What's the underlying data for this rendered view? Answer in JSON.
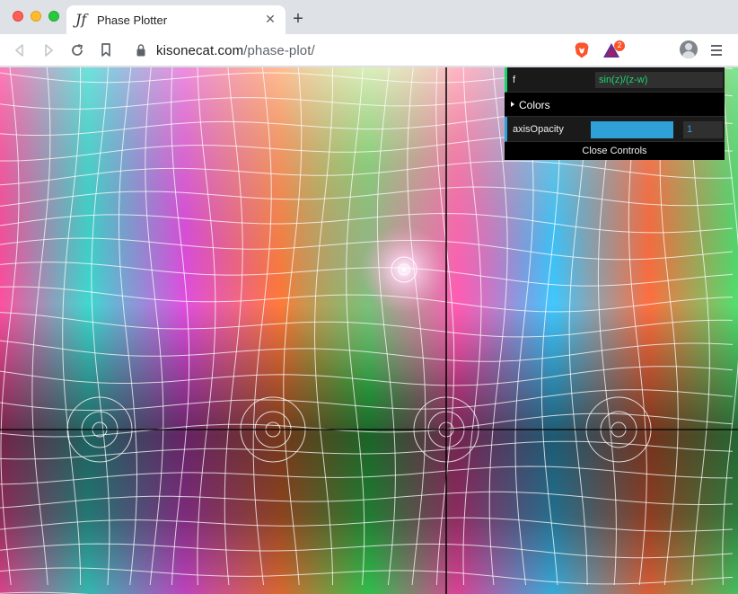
{
  "window": {
    "tab_title": "Phase Plotter",
    "tab_favicon": "Jf",
    "url_host": "kisonecat.com",
    "url_path": "/phase-plot/",
    "extension_badge": "2"
  },
  "icons": {
    "back": "arrow-left-icon",
    "forward": "arrow-right-icon",
    "reload": "reload-icon",
    "bookmark": "bookmark-icon",
    "lock": "lock-icon",
    "brave": "brave-shield-icon",
    "rewards": "bat-rewards-icon",
    "profile": "profile-icon",
    "menu": "hamburger-menu-icon"
  },
  "controls": {
    "f_label": "f",
    "f_value": "sin(z)/(z-w)",
    "colors_folder": "Colors",
    "axis_opacity_label": "axisOpacity",
    "axis_opacity_value": "1",
    "axis_opacity_level": 1,
    "close_label": "Close Controls"
  },
  "colors": {
    "string_accent": "#1ed36f",
    "number_accent": "#2fa1d6",
    "gui_background": "#000000"
  }
}
